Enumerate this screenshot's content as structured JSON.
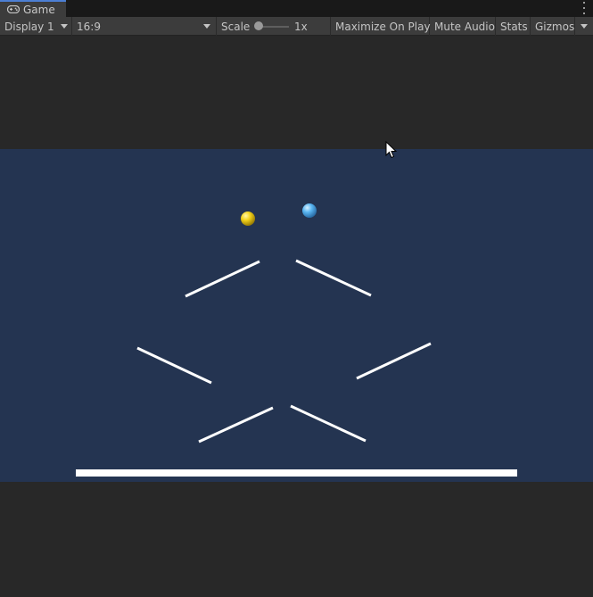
{
  "window": {
    "tab_label": "Game",
    "tab_icon": "gamepad-icon",
    "menu_icon": "kebab-menu-icon"
  },
  "toolbar": {
    "display_label": "Display 1",
    "aspect_label": "16:9",
    "scale_label": "Scale",
    "scale_value_label": "1x",
    "scale_value": 1,
    "maximize_label": "Maximize On Play",
    "mute_label": "Mute Audio",
    "stats_label": "Stats",
    "gizmos_label": "Gizmos"
  },
  "scene": {
    "background_color": "#243451",
    "balls": [
      {
        "name": "yellow-ball",
        "color": "#f3d21a"
      },
      {
        "name": "blue-ball",
        "color": "#5ab6f2"
      }
    ],
    "platform_color": "#ffffff"
  },
  "colors": {
    "editor_bg": "#282828",
    "toolbar_bg": "#3c3c3c",
    "tab_accent": "#4c7fd4"
  }
}
